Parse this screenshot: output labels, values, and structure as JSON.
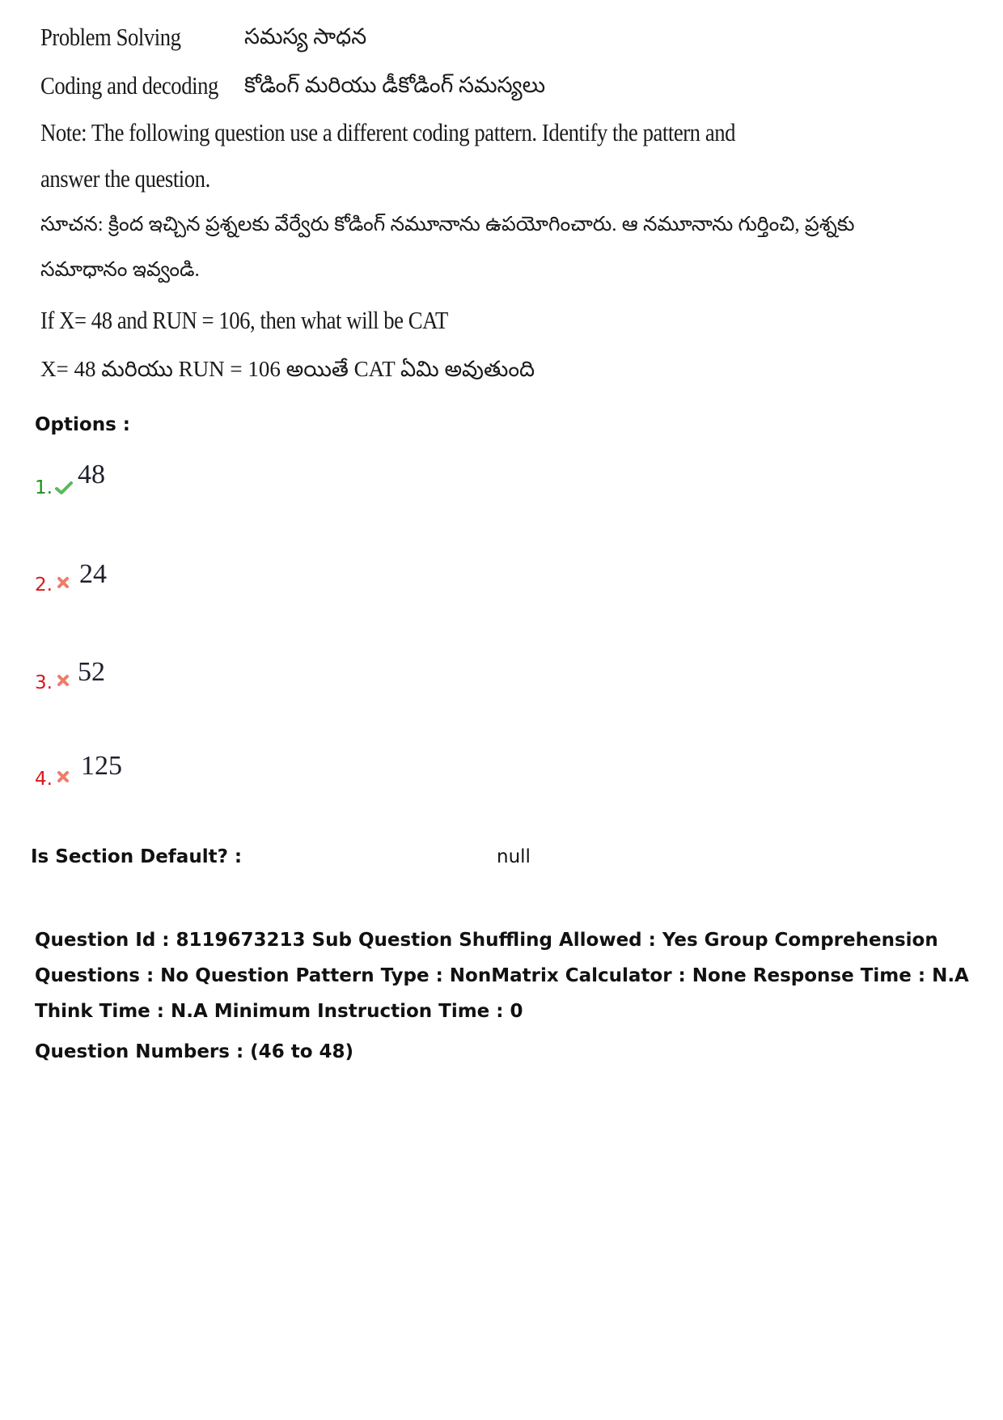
{
  "question": {
    "section_en": "Problem Solving",
    "section_te": "సమస్య సాధన",
    "topic_en": "Coding and decoding",
    "topic_te": "కోడింగ్ మరియు డీకోడింగ్ సమస్యలు",
    "note_en_line1": "Note: The following question use a different coding pattern. Identify the pattern and",
    "note_en_line2": "answer the question.",
    "note_te_line1": "సూచన: క్రింద ఇచ్చిన ప్రశ్నలకు వేర్వేరు కోడింగ్ నమూనాను ఉపయోగించారు. ఆ నమూనాను గుర్తించి, ప్రశ్నకు",
    "note_te_line2": "సమాధానం ఇవ్వండి.",
    "stem_en": "If X= 48 and RUN = 106, then what will be CAT",
    "stem_te": "X= 48 మరియు  RUN = 106 అయితే  CAT ఏమి అవుతుంది"
  },
  "options_label": "Options :",
  "options": [
    {
      "number": "1.",
      "value": "48",
      "status": "correct",
      "icon": "check-icon"
    },
    {
      "number": "2.",
      "value": "24",
      "status": "wrong",
      "icon": "cross-icon"
    },
    {
      "number": "3.",
      "value": "52",
      "status": "wrong",
      "icon": "cross-icon"
    },
    {
      "number": "4.",
      "value": "125",
      "status": "wrong",
      "icon": "cross-icon"
    }
  ],
  "section_default": {
    "label": "Is Section Default? :",
    "value": "null"
  },
  "meta": {
    "line1": "Question Id : 8119673213 Sub Question Shuffling Allowed : Yes Group Comprehension",
    "line2": "Questions : No Question Pattern Type : NonMatrix Calculator : None Response Time : N.A",
    "line3": "Think Time : N.A Minimum Instruction Time : 0",
    "question_numbers": "Question Numbers : (46 to 48)"
  },
  "colors": {
    "correct": "#1c8f1c",
    "wrong": "#d61a1a",
    "check_icon": "#5cb85c",
    "cross_icon": "#f07c6c"
  }
}
